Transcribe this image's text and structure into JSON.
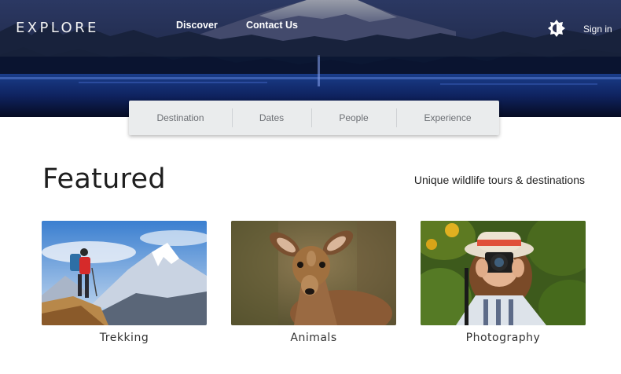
{
  "header": {
    "brand": "EXPLORE",
    "nav": [
      {
        "label": "Discover"
      },
      {
        "label": "Contact Us"
      }
    ],
    "theme_toggle_icon": "brightness-icon",
    "signin_label": "Sign in"
  },
  "search": {
    "segments": [
      {
        "label": "Destination"
      },
      {
        "label": "Dates"
      },
      {
        "label": "People"
      },
      {
        "label": "Experience"
      }
    ]
  },
  "featured": {
    "title": "Featured",
    "subtitle": "Unique wildlife tours & destinations",
    "cards": [
      {
        "label": "Trekking",
        "image": "hiker-mountain-image"
      },
      {
        "label": "Animals",
        "image": "deer-image"
      },
      {
        "label": "Photography",
        "image": "photographer-image"
      }
    ]
  },
  "colors": {
    "hero_dark": "#0c1430",
    "searchbar_bg": "#eaeced",
    "text_primary": "#1e1e1e",
    "segment_text": "#6c6f74"
  }
}
